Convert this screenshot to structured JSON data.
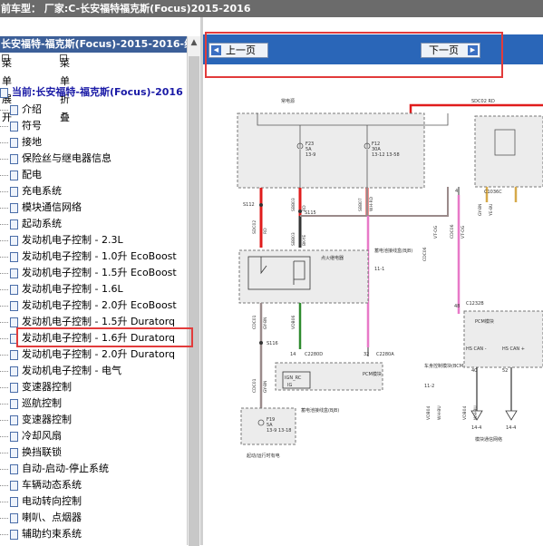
{
  "title_bar": "前车型： 厂家:C-长安福特福克斯(Focus)2015-2016",
  "tree_header": "长安福特-福克斯(Focus)-2015-2016-线路",
  "toolbar": {
    "expand": "菜单展开",
    "collapse": "菜单折叠"
  },
  "tree_root": "当前:长安福特-福克斯(Focus)-2016",
  "tree_items": [
    "介绍",
    "符号",
    "接地",
    "保险丝与继电器信息",
    "配电",
    "充电系统",
    "模块通信网络",
    "起动系统",
    "发动机电子控制 - 2.3L",
    "发动机电子控制 - 1.0升 EcoBoost",
    "发动机电子控制 - 1.5升 EcoBoost",
    "发动机电子控制 - 1.6L",
    "发动机电子控制 - 2.0升 EcoBoost",
    "发动机电子控制 - 1.5升 Duratorq",
    "发动机电子控制 - 1.6升 Duratorq",
    "发动机电子控制 - 2.0升 Duratorq",
    "发动机电子控制 - 电气",
    "变速器控制",
    "巡航控制",
    "变速器控制",
    "冷却风扇",
    "换挡联锁",
    "自动-启动-停止系统",
    "车辆动态系统",
    "电动转向控制",
    "喇叭、点烟器",
    "辅助约束系统"
  ],
  "selected_item_index": 14,
  "nav": {
    "prev": "上一页",
    "next": "下一页"
  },
  "diagram": {
    "labels": {
      "always_hot": "常电源",
      "sdc02_rd": "SDC02 RD",
      "f23": "F23",
      "f23_amp": "5A",
      "f23_pins": "13-9",
      "f12": "F12",
      "f12_amp": "30A",
      "f12_pins": "13-12 13-58",
      "s112": "S112",
      "s115": "S115",
      "c1036c": "C1036C",
      "sdc02": "SDC02",
      "rd": "RD",
      "sbb07": "SBB07",
      "wh_rd": "WH-RD",
      "gy_bn": "GY-BN",
      "ye_bu": "YE-BU",
      "vt_og": "VT-OG",
      "sbb03": "SBB03",
      "bk_ye": "BK-YE",
      "pin4": "4",
      "bjb_title": "蓄电池接线盒(BJB)",
      "ignition_relay": "点火继电器",
      "ref_11_1": "11-1",
      "cdc01": "CDC01",
      "cdc06": "CDC06",
      "vdb06": "VDB06",
      "c1232b": "C1232B",
      "pin48": "48",
      "pcm": "PCM模块",
      "s116": "S116",
      "c2280d": "C2280D",
      "c2280a": "C2280A",
      "pin14": "14",
      "pin32": "32",
      "bcm_box": "PCM模块",
      "bcm": "车身控制模块(BCM)",
      "ref_11_2": "11-2",
      "ign_rc": "IGN_RC",
      "pin_label": "IG",
      "hs_can_plus": "HS CAN +",
      "hs_can_minus": "HS CAN -",
      "pin40": "40",
      "pin52": "52",
      "vdb04": "VDB04",
      "wh_bu": "WH-BU",
      "ref_14_4": "14-4",
      "ref_14_4b": "14-4",
      "bjb_bottom": "蓄电池接线盒(BJB)",
      "f19": "F19",
      "f19_amp": "5A",
      "f19_pins": "13-9 13-18",
      "run_start": "起动/运行时有电",
      "can_network": "模块通信网络"
    }
  },
  "colors": {
    "header_blue": "#3c5f98",
    "nav_blue": "#2a66b8",
    "highlight_red": "#e23b3b",
    "wire_red": "#e01c1c",
    "wire_green": "#2e8b2e",
    "wire_pink": "#e879c8",
    "wire_gray": "#9a8a8a"
  }
}
